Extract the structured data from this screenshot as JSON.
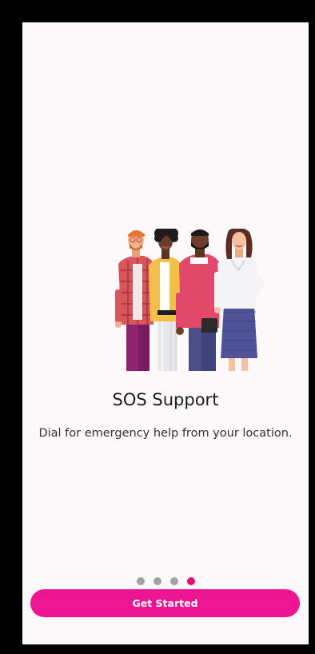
{
  "onboarding": {
    "title": "SOS Support",
    "description": "Dial for emergency help from your location.",
    "illustration_icon": "group-of-people-illustration",
    "pager": {
      "total": 4,
      "active_index": 3
    },
    "cta_label": "Get Started"
  },
  "colors": {
    "accent": "#ed1590",
    "active_dot": "#e7106f",
    "inactive_dot": "#a3a3a3",
    "background": "#fcf9fa"
  }
}
